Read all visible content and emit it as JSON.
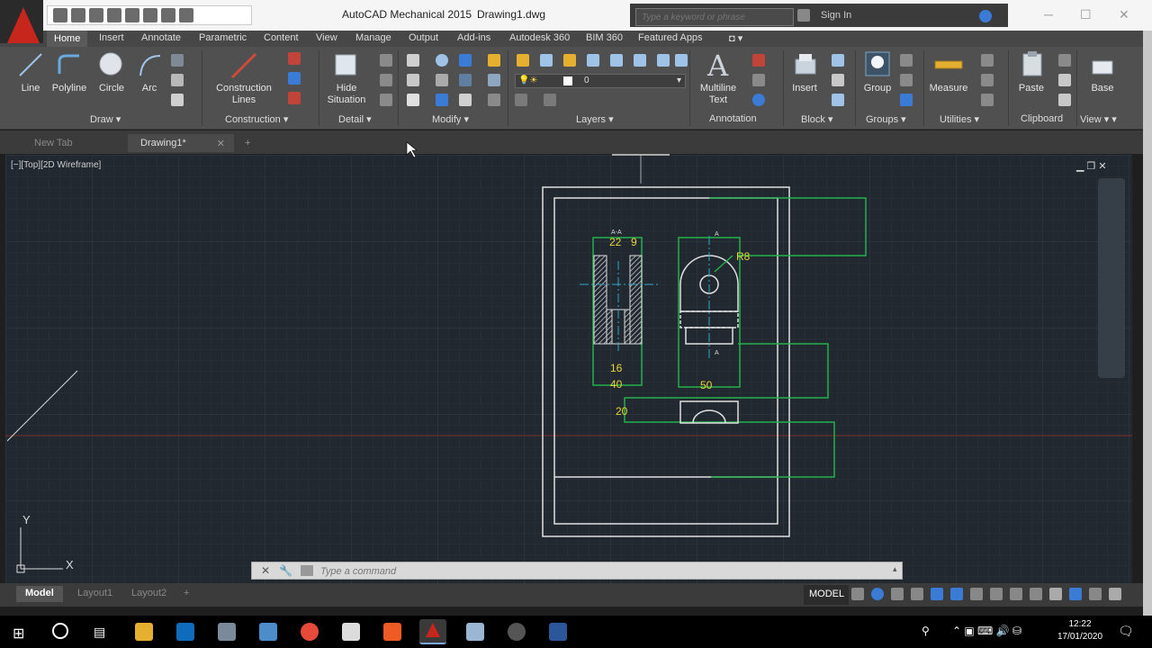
{
  "window": {
    "title": "AutoCAD Mechanical 2015",
    "file": "Drawing1.dwg",
    "search_placeholder": "Type a keyword or phrase",
    "sign_in": "Sign In"
  },
  "ribbon_tabs": [
    "Home",
    "Insert",
    "Annotate",
    "Parametric",
    "Content",
    "View",
    "Manage",
    "Output",
    "Add-ins",
    "Autodesk 360",
    "BIM 360",
    "Featured Apps"
  ],
  "ribbon": {
    "draw": {
      "title": "Draw",
      "line": "Line",
      "polyline": "Polyline",
      "circle": "Circle",
      "arc": "Arc"
    },
    "construction": {
      "title": "Construction",
      "btn_line1": "Construction",
      "btn_line2": "Lines"
    },
    "detail": {
      "title": "Detail",
      "btn_line1": "Hide",
      "btn_line2": "Situation"
    },
    "modify": {
      "title": "Modify"
    },
    "layers": {
      "title": "Layers",
      "layer_value": "0"
    },
    "annotation": {
      "title": "Annotation",
      "btn_line1": "Multiline",
      "btn_line2": "Text"
    },
    "block": {
      "title": "Block",
      "btn": "Insert"
    },
    "groups": {
      "title": "Groups",
      "btn": "Group"
    },
    "utilities": {
      "title": "Utilities",
      "btn": "Measure"
    },
    "clipboard": {
      "title": "Clipboard",
      "btn": "Paste"
    },
    "view": {
      "title": "View",
      "btn": "Base"
    }
  },
  "doc_tabs": [
    "New Tab",
    "Drawing1*"
  ],
  "viewport": {
    "label": "[−][Top][2D Wireframe]",
    "ucs_y": "Y",
    "ucs_x": "X"
  },
  "dimensions": {
    "aa": "A-A",
    "top_left": "22",
    "top_right": "9",
    "radius": "R8",
    "d16": "16",
    "d40": "40",
    "d50": "50",
    "d20": "20",
    "sec_a_top": "A",
    "sec_a_bottom": "A"
  },
  "command": {
    "placeholder": "Type a command"
  },
  "layout_tabs": [
    "Model",
    "Layout1",
    "Layout2"
  ],
  "status": {
    "model": "MODEL"
  },
  "taskbar": {
    "time": "12:22",
    "date": "17/01/2020"
  },
  "colors": {
    "green": "#22b14c",
    "yellow": "#e8d43a",
    "cyan": "#2fa7c4",
    "white": "#e8e8e8",
    "red_axis": "#7a2b2b",
    "ribbon_bg": "#505050"
  }
}
